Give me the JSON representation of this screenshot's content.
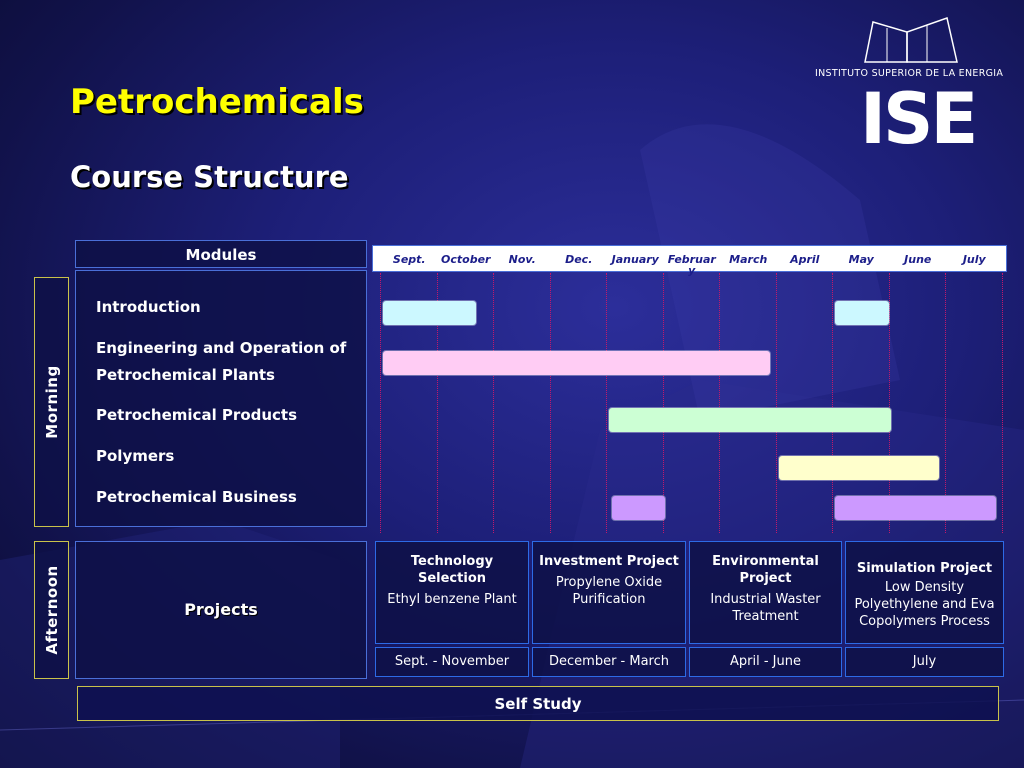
{
  "slide": {
    "title": "Petrochemicals",
    "subtitle": "Course Structure"
  },
  "logo": {
    "institution": "INSTITUTO SUPERIOR DE LA ENERGIA",
    "acronym": "ISE"
  },
  "modules": {
    "header": "Modules",
    "items": [
      "Introduction",
      "Engineering and Operation of",
      "Petrochemical Plants",
      "Petrochemical Products",
      "Polymers",
      "Petrochemical Business"
    ]
  },
  "sections": {
    "morning": "Morning",
    "afternoon": "Afternoon"
  },
  "timeline": {
    "months": [
      "Sept.",
      "October",
      "Nov.",
      "Dec.",
      "January",
      "Februar y",
      "March",
      "April",
      "May",
      "June",
      "July"
    ],
    "bars": [
      {
        "module": "Introduction",
        "start": 0,
        "end": 1.7,
        "color": "#ccf8ff"
      },
      {
        "module": "Introduction",
        "start": 8,
        "end": 9.0,
        "color": "#ccf8ff"
      },
      {
        "module": "Engineering and Operation of Petrochemical Plants",
        "start": 0,
        "end": 6.9,
        "color": "#ffccf4"
      },
      {
        "module": "Petrochemical Products",
        "start": 4,
        "end": 9.05,
        "color": "#ccffd4"
      },
      {
        "module": "Polymers",
        "start": 7,
        "end": 9.9,
        "color": "#ffffcc"
      },
      {
        "module": "Petrochemical Business",
        "start": 4.05,
        "end": 5.05,
        "color": "#cc99ff"
      },
      {
        "module": "Petrochemical Business",
        "start": 8,
        "end": 10.9,
        "color": "#cc99ff"
      }
    ]
  },
  "projects": {
    "label": "Projects",
    "items": [
      {
        "title": "Technology Selection",
        "desc": "Ethyl benzene Plant",
        "period": "Sept. - November"
      },
      {
        "title": "Investment Project",
        "desc": "Propylene Oxide Purification",
        "period": "December - March"
      },
      {
        "title": "Environmental Project",
        "desc": "Industrial Waster Treatment",
        "period": "April - June"
      },
      {
        "title": "Simulation Project",
        "desc": "Low Density Polyethylene and Eva Copolymers Process",
        "period": "July"
      }
    ]
  },
  "self_study": "Self Study",
  "colors": {
    "title": "#ffff00",
    "background": "#1d1f78",
    "border": "#2d6ae6",
    "month_text": "#1c1e8a",
    "gridline": "#c2186b"
  }
}
